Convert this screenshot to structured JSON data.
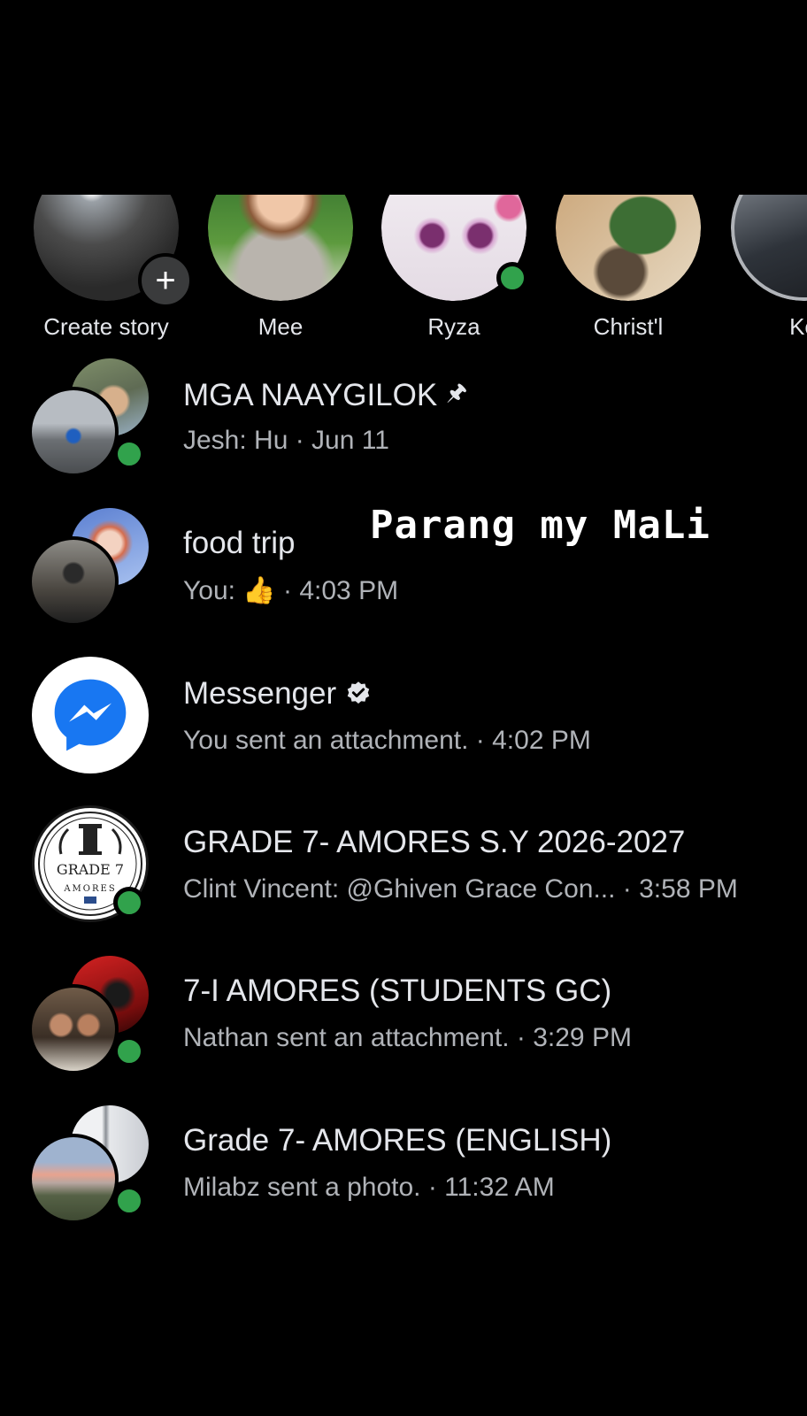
{
  "stories": [
    {
      "name": "Create story",
      "is_create": true,
      "online": false,
      "colors": [
        "#3b3b3b",
        "#6a6a6a"
      ]
    },
    {
      "name": "Mee",
      "is_create": false,
      "online": false,
      "colors": [
        "#2f6d2b",
        "#d9b69a"
      ]
    },
    {
      "name": "Ryza",
      "is_create": false,
      "online": true,
      "colors": [
        "#e9dfe8",
        "#c6a0c6"
      ]
    },
    {
      "name": "Christ'l",
      "is_create": false,
      "online": false,
      "colors": [
        "#c9a375",
        "#3e6e3a"
      ]
    },
    {
      "name": "Ke",
      "is_create": false,
      "online": false,
      "colors": [
        "#3a3f48",
        "#9ea4ad"
      ]
    }
  ],
  "create_story_plus": "+",
  "overlay_text": "Parang my MaLi",
  "chats": [
    {
      "title": "MGA NAAYGILOK",
      "pinned": true,
      "pin_glyph": "🖈",
      "subtitle": "Jesh: Hu · Jun 11",
      "avatar_type": "group",
      "online": true,
      "colors": [
        "#7f8f6a",
        "#3b5c8a"
      ]
    },
    {
      "title": "food trip",
      "pinned": false,
      "subtitle_prefix": "You:",
      "subtitle_emoji": "👍",
      "subtitle_time": "· 4:03 PM",
      "avatar_type": "group",
      "online": false,
      "colors": [
        "#d98a7a",
        "#4a4640"
      ]
    },
    {
      "title": "Messenger",
      "verified": true,
      "subtitle": "You sent an attachment. · 4:02 PM",
      "avatar_type": "messenger",
      "online": false
    },
    {
      "title": "GRADE 7- AMORES S.Y 2026-2027",
      "subtitle": "Clint Vincent: @Ghiven Grace Con...  · 3:58 PM",
      "avatar_type": "logo",
      "logo_top": "GRADE 7",
      "logo_bottom": "AMORES",
      "online": true
    },
    {
      "title": "7-I AMORES (STUDENTS GC)",
      "subtitle": "Nathan sent an attachment. · 3:29 PM",
      "avatar_type": "group",
      "online": true,
      "colors": [
        "#b11a1a",
        "#6f5b48"
      ]
    },
    {
      "title": "Grade 7- AMORES (ENGLISH)",
      "subtitle": "Milabz sent a photo. · 11:32 AM",
      "avatar_type": "group",
      "online": true,
      "colors": [
        "#c9ccd2",
        "#6c7a5a"
      ]
    }
  ]
}
